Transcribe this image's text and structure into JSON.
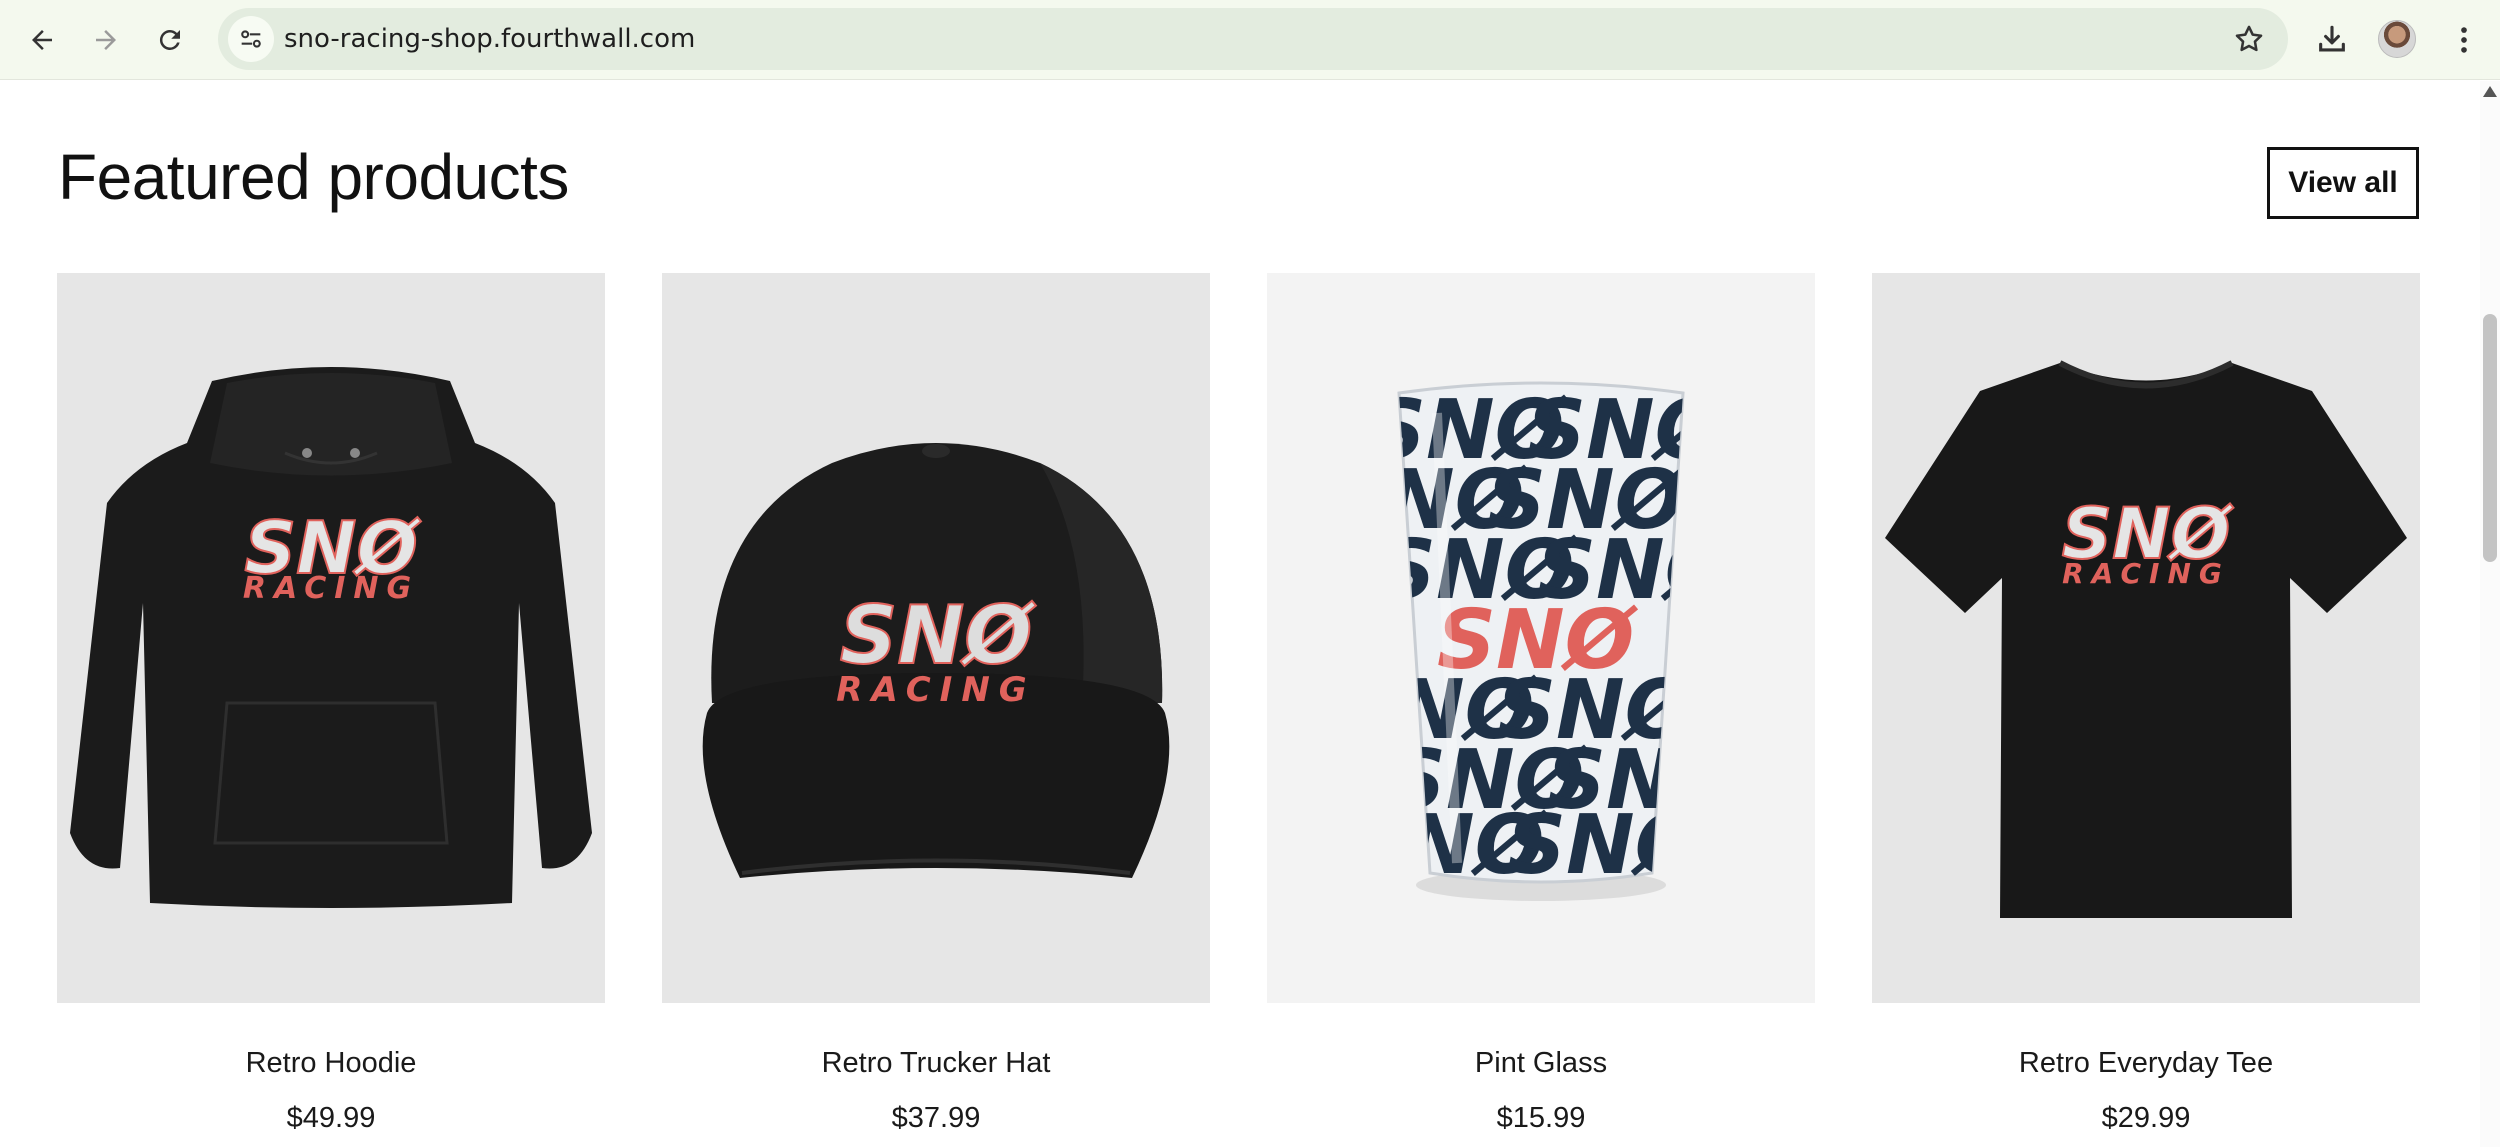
{
  "browser": {
    "url": "sno-racing-shop.fourthwall.com",
    "icons": [
      "back-icon",
      "forward-icon",
      "reload-icon",
      "site-info-icon",
      "star-icon",
      "download-icon",
      "profile-avatar",
      "menu-icon"
    ]
  },
  "section": {
    "title": "Featured products",
    "view_all_label": "View all"
  },
  "brand": {
    "logo_top": "SNØ",
    "logo_bottom": "RACING",
    "accent_color": "#e0625c",
    "glass_pattern_color": "#1e3147"
  },
  "products": [
    {
      "name": "Retro Hoodie",
      "price": "$49.99",
      "image": "black-hoodie"
    },
    {
      "name": "Retro Trucker Hat",
      "price": "$37.99",
      "image": "black-trucker-hat"
    },
    {
      "name": "Pint Glass",
      "price": "$15.99",
      "image": "patterned-pint-glass"
    },
    {
      "name": "Retro Everyday Tee",
      "price": "$29.99",
      "image": "black-tee"
    }
  ]
}
